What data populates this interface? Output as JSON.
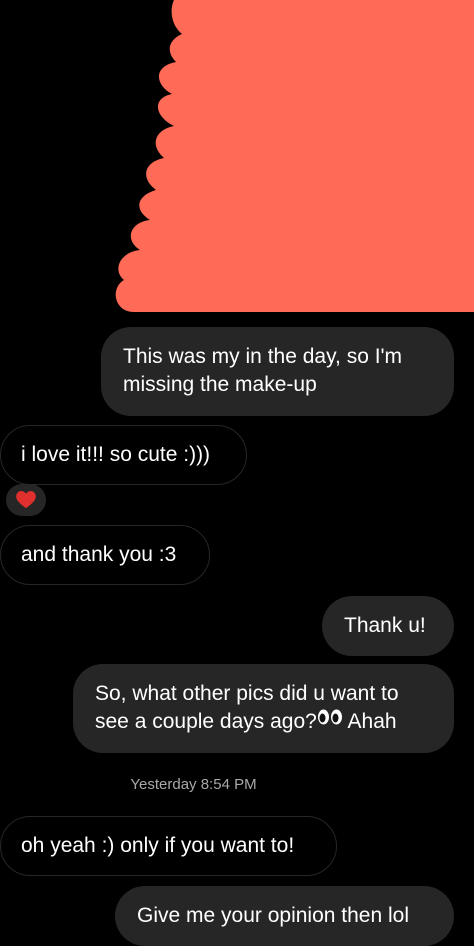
{
  "colors": {
    "background": "#000000",
    "sent_bubble": "#262626",
    "received_border": "#262626",
    "redaction": "#FF6B57",
    "reaction_heart": "#E0302E",
    "timestamp_text": "#A8A8A8"
  },
  "messages": [
    {
      "id": "m1",
      "direction": "sent",
      "lines": [
        "This was my in the day, so I'm",
        "missing the make-up"
      ]
    },
    {
      "id": "m2",
      "direction": "received",
      "text": "i love it!!! so cute :)))",
      "reaction": "red-heart"
    },
    {
      "id": "m3",
      "direction": "received",
      "text": "and thank you :3"
    },
    {
      "id": "m4",
      "direction": "sent",
      "text": "Thank u!"
    },
    {
      "id": "m5",
      "direction": "sent",
      "lines": [
        "So, what other pics did u want to",
        "see a couple days ago?",
        "Ahah"
      ],
      "emoji": "eyes-icon"
    },
    {
      "id": "m7",
      "direction": "received",
      "text": "oh yeah :) only if you want to!"
    },
    {
      "id": "m8",
      "direction": "sent",
      "text": "Give me your opinion then lol"
    }
  ],
  "timestamp": "Yesterday 8:54 PM"
}
